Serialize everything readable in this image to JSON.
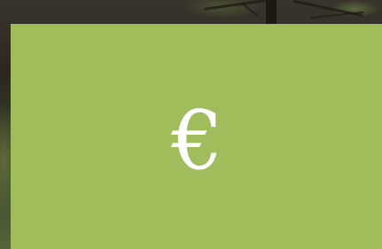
{
  "background": {
    "description_color": "#2f2a22"
  },
  "card": {
    "color": "#a0bd5c",
    "symbol": "€",
    "symbol_color": "#ffffff"
  }
}
